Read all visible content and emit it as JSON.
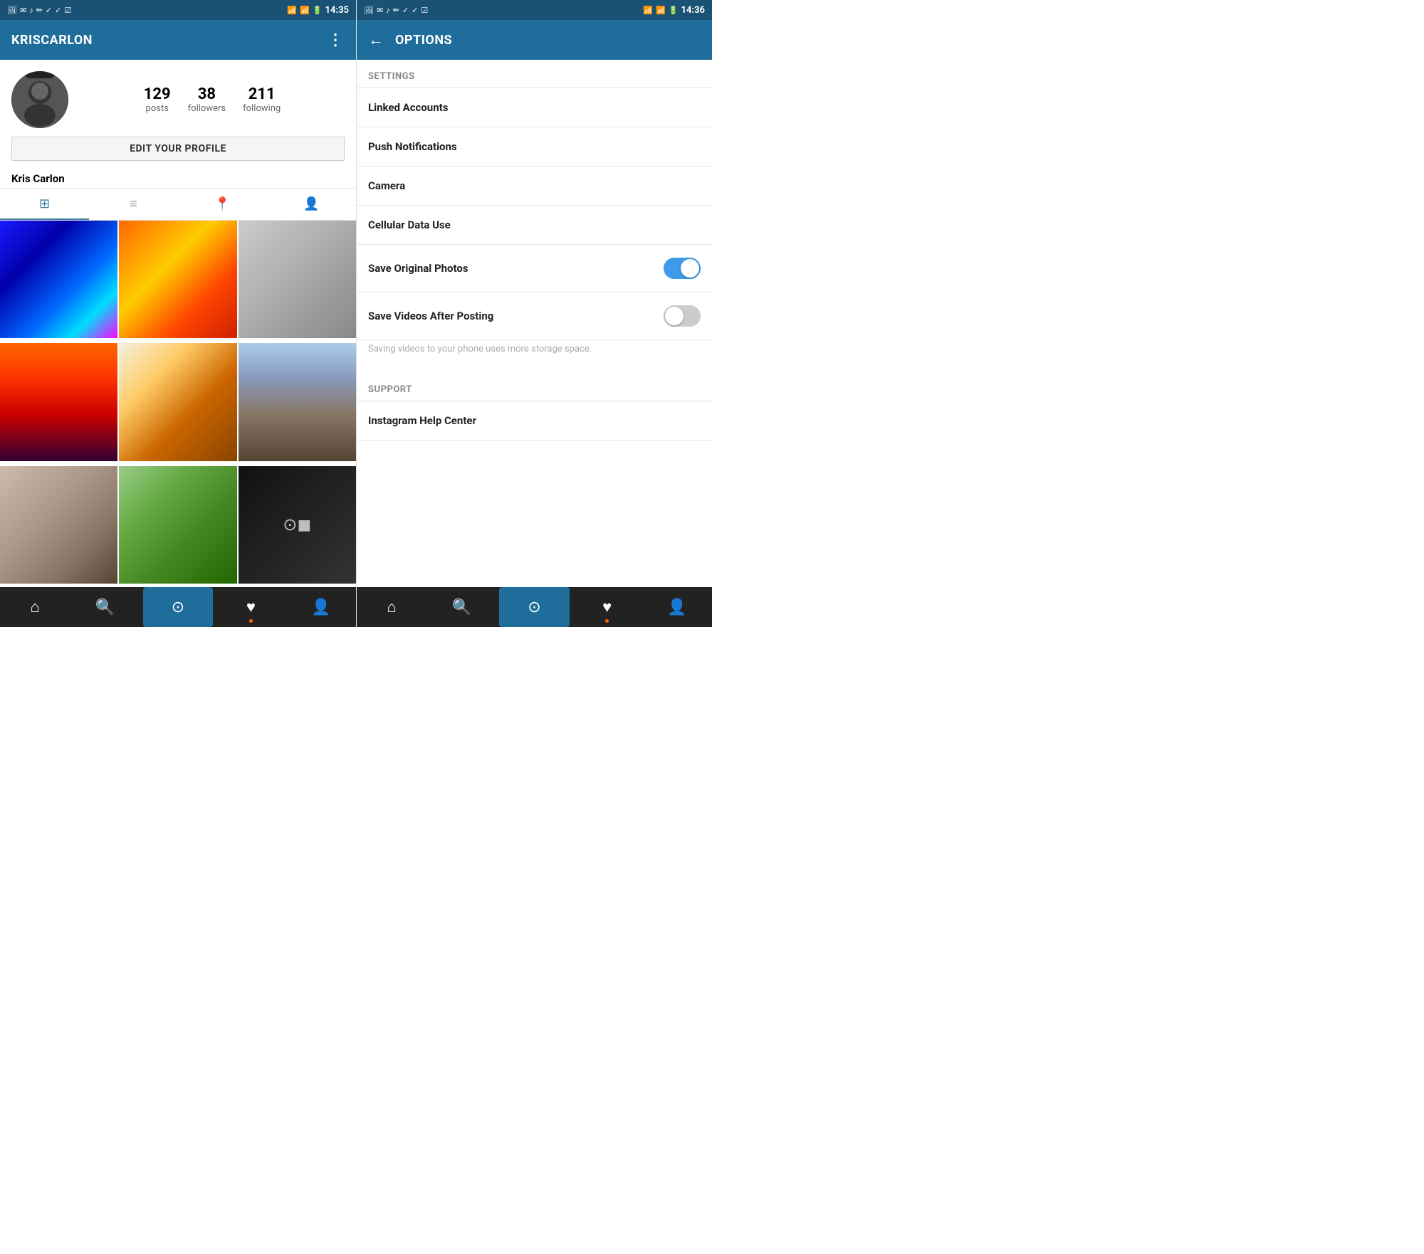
{
  "left": {
    "statusBar": {
      "time": "14:35",
      "battery": "90%"
    },
    "header": {
      "title": "KRISCARLON",
      "menuIcon": "⋮"
    },
    "profile": {
      "stats": [
        {
          "number": "129",
          "label": "posts"
        },
        {
          "number": "38",
          "label": "followers"
        },
        {
          "number": "211",
          "label": "following"
        }
      ],
      "editButton": "EDIT YOUR PROFILE",
      "name": "Kris Carlon"
    },
    "tabs": [
      {
        "icon": "⊞",
        "active": true
      },
      {
        "icon": "≡",
        "active": false
      },
      {
        "icon": "◎",
        "active": false
      },
      {
        "icon": "◻",
        "active": false
      }
    ],
    "bottomNav": [
      {
        "icon": "⌂",
        "label": "home"
      },
      {
        "icon": "🔍",
        "label": "search"
      },
      {
        "icon": "⊙",
        "label": "camera",
        "active": true
      },
      {
        "icon": "♥",
        "label": "likes",
        "dot": true
      },
      {
        "icon": "👤",
        "label": "profile"
      }
    ]
  },
  "right": {
    "statusBar": {
      "time": "14:36",
      "battery": "90%"
    },
    "header": {
      "backIcon": "←",
      "title": "OPTIONS"
    },
    "settings": {
      "sectionLabel": "SETTINGS",
      "items": [
        {
          "label": "Linked Accounts",
          "type": "link"
        },
        {
          "label": "Push Notifications",
          "type": "link"
        },
        {
          "label": "Camera",
          "type": "link"
        },
        {
          "label": "Cellular Data Use",
          "type": "link"
        },
        {
          "label": "Save Original Photos",
          "type": "toggle",
          "value": true
        },
        {
          "label": "Save Videos After Posting",
          "type": "toggle",
          "value": false
        }
      ],
      "hint": "Saving videos to your phone uses more storage space.",
      "supportLabel": "SUPPORT",
      "supportItems": [
        {
          "label": "Instagram Help Center",
          "type": "link"
        }
      ]
    },
    "bottomNav": [
      {
        "icon": "⌂",
        "label": "home"
      },
      {
        "icon": "🔍",
        "label": "search"
      },
      {
        "icon": "⊙",
        "label": "camera",
        "active": true
      },
      {
        "icon": "♥",
        "label": "likes",
        "dot": true
      },
      {
        "icon": "👤",
        "label": "profile"
      }
    ]
  }
}
